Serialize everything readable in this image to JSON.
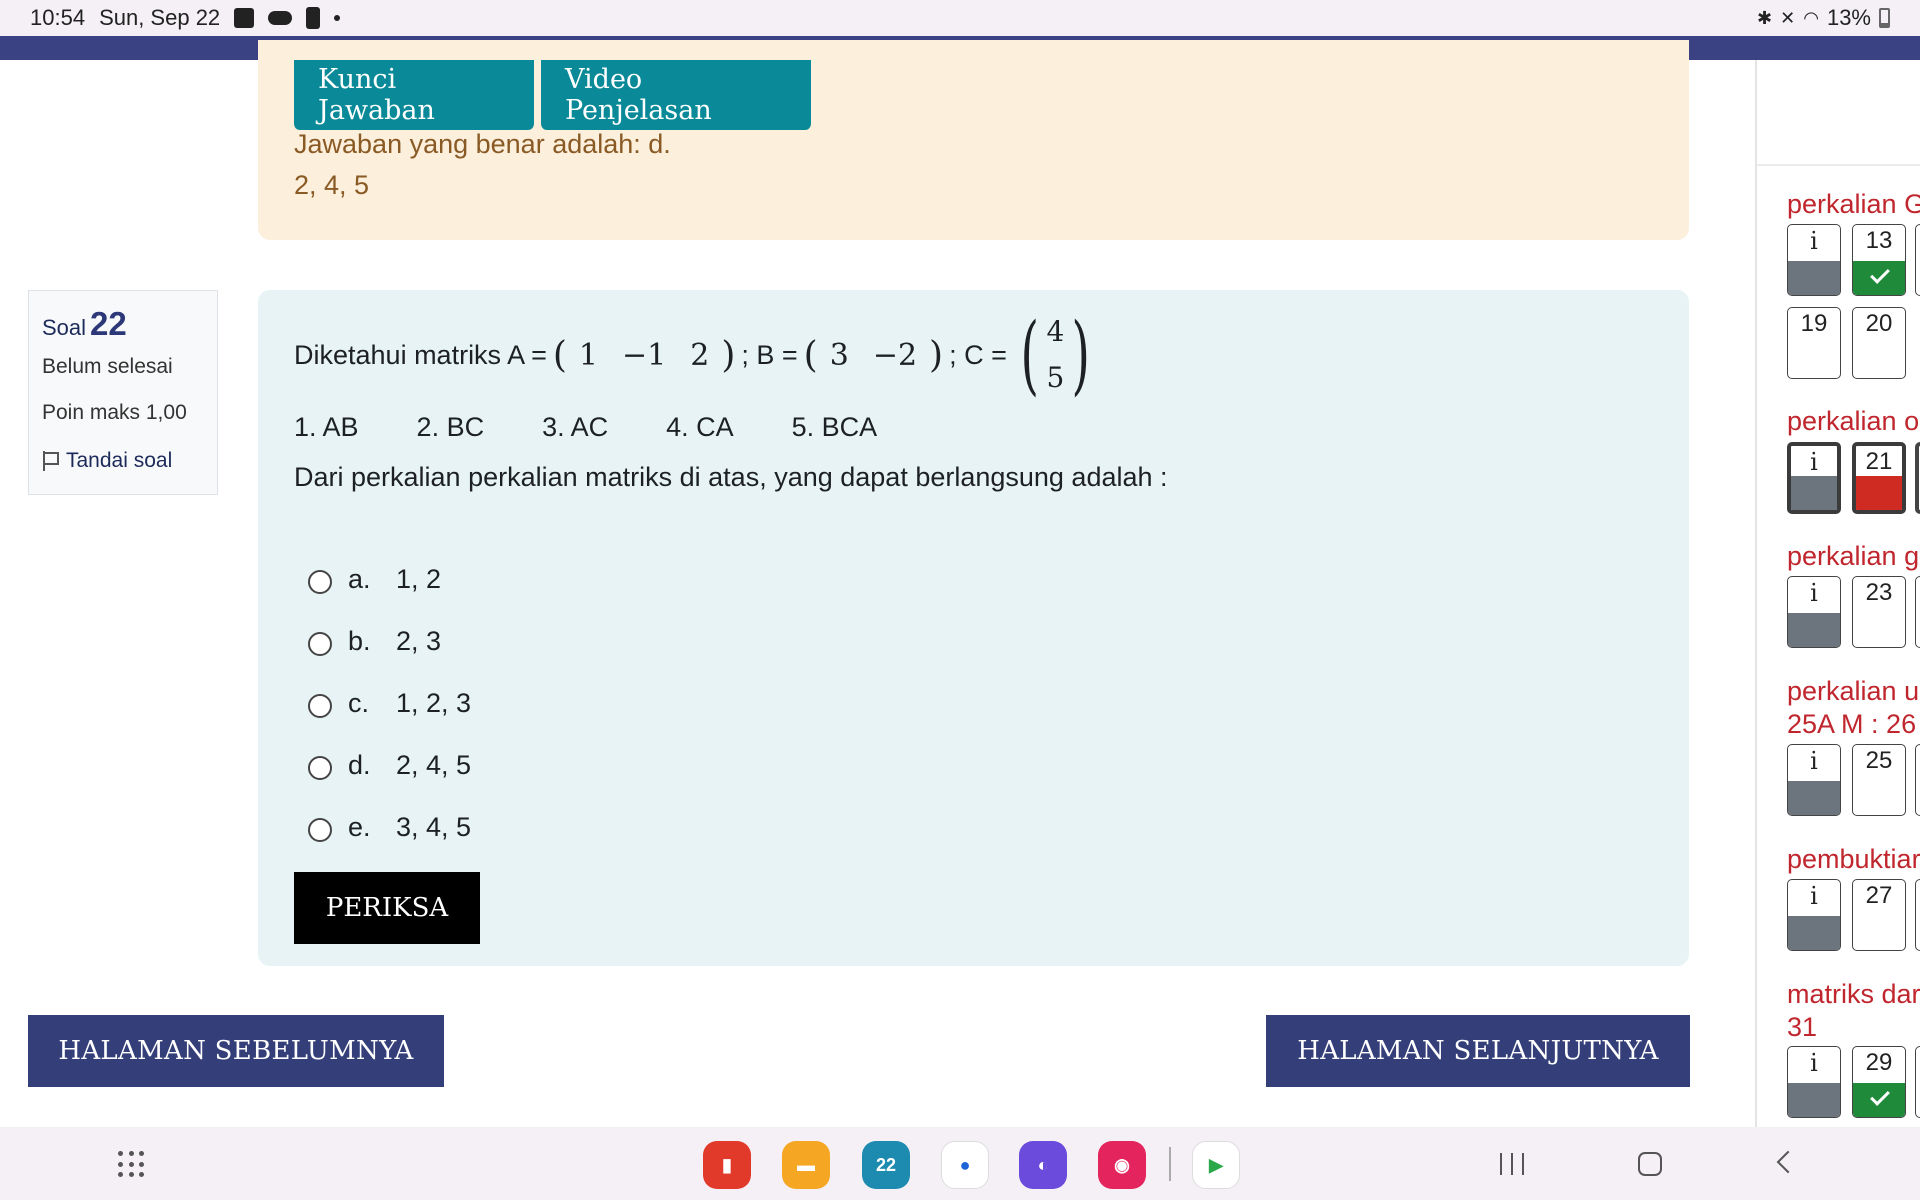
{
  "status_bar": {
    "time": "10:54",
    "date": "Sun, Sep 22",
    "battery": "13%"
  },
  "feedback": {
    "kunci_label": "Kunci Jawaban",
    "video_label": "Video Penjelasan",
    "correct_line": "Jawaban yang benar adalah: d.",
    "correct_value": "2, 4, 5"
  },
  "question_info": {
    "soal_label": "Soal",
    "number": "22",
    "status": "Belum selesai",
    "points": "Poin maks 1,00",
    "flag_label": "Tandai soal"
  },
  "question": {
    "intro": "Diketahui matriks A =",
    "matrix_a": [
      "1",
      "−1",
      "2"
    ],
    "sep_b": "; B =",
    "matrix_b": [
      "3",
      "−2"
    ],
    "sep_c": "; C =",
    "vector_c": [
      "4",
      "5"
    ],
    "products": [
      "1. AB",
      "2. BC",
      "3. AC",
      "4. CA",
      "5. BCA"
    ],
    "prompt": "Dari perkalian perkalian matriks di atas, yang dapat berlangsung adalah :",
    "answers": [
      {
        "letter": "a.",
        "text": "1, 2"
      },
      {
        "letter": "b.",
        "text": "2, 3"
      },
      {
        "letter": "c.",
        "text": "1, 2, 3"
      },
      {
        "letter": "d.",
        "text": "2, 4, 5"
      },
      {
        "letter": "e.",
        "text": "3, 4, 5"
      }
    ],
    "check_label": "PERIKSA"
  },
  "navigation": {
    "prev_label": "HALAMAN SEBELUMNYA",
    "next_label": "HALAMAN SELANJUTNYA"
  },
  "quiz_nav": {
    "sections": [
      {
        "title": "perkalian G",
        "tiles": [
          {
            "label": "i",
            "state": "info"
          },
          {
            "label": "13",
            "state": "correct"
          }
        ]
      },
      {
        "title": "",
        "tiles": [
          {
            "label": "19",
            "state": "empty"
          },
          {
            "label": "20",
            "state": "empty"
          }
        ]
      },
      {
        "title": "perkalian o",
        "tiles": [
          {
            "label": "i",
            "state": "info-current"
          },
          {
            "label": "21",
            "state": "wrong-current"
          }
        ]
      },
      {
        "title": "perkalian g",
        "tiles": [
          {
            "label": "i",
            "state": "info"
          },
          {
            "label": "23",
            "state": "empty"
          }
        ]
      },
      {
        "title": "perkalian u",
        "title2": "25A M : 26",
        "tiles": [
          {
            "label": "i",
            "state": "info"
          },
          {
            "label": "25",
            "state": "empty"
          }
        ]
      },
      {
        "title": "pembuktiar",
        "tiles": [
          {
            "label": "i",
            "state": "info"
          },
          {
            "label": "27",
            "state": "empty"
          }
        ]
      },
      {
        "title": "matriks dar",
        "title2": "31",
        "tiles": [
          {
            "label": "i",
            "state": "info"
          },
          {
            "label": "29",
            "state": "correct"
          }
        ]
      }
    ]
  },
  "dock": {
    "calendar_day": "22",
    "apps": [
      "notes-app",
      "files-app",
      "calendar-app",
      "messages-app",
      "internet-app",
      "screen-recorder-app",
      "play-store-app"
    ]
  },
  "colors": {
    "brand_navy": "#343f7a",
    "teal_button": "#0a8a98",
    "feedback_bg": "#fcefdc",
    "question_bg": "#e7f3f5",
    "section_red": "#c0262d",
    "correct_green": "#1f8a3a",
    "wrong_red": "#d02b22"
  }
}
